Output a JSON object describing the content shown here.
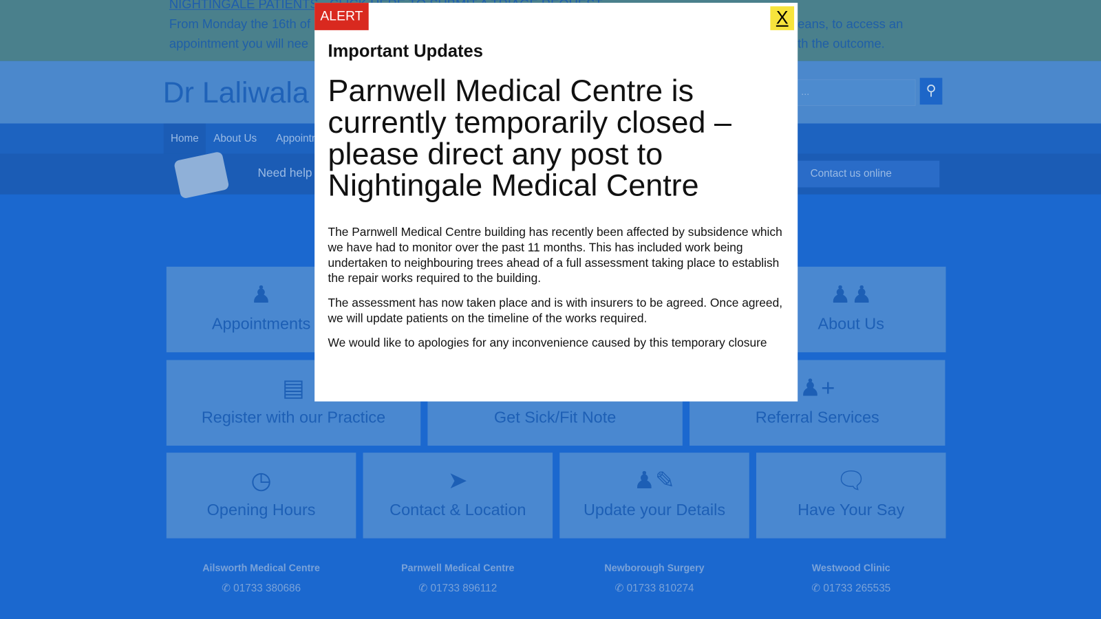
{
  "banner": {
    "line1": "NIGHTINGALE PATIENTS - CLICK HERE TO SUBMIT A TRIAGE REQUEST",
    "line2_left": "From Monday the 16th of",
    "line2_right": "eans, to access an",
    "line3_left": "appointment you will nee",
    "line3_right": "th the outcome."
  },
  "header": {
    "logo": "Dr Laliwala &",
    "search_placeholder": "...",
    "search_icon": "search-icon"
  },
  "nav": [
    "Home",
    "About Us",
    "Appointm"
  ],
  "helpbar": {
    "text": "Need help",
    "contact_button": "Contact us online"
  },
  "tiles": [
    {
      "label": "Appointments",
      "icon": "doctor-icon"
    },
    {
      "label": "About Us",
      "icon": "users-icon"
    },
    {
      "label": "Register with our Practice",
      "icon": "id-card-icon"
    },
    {
      "label": "Get Sick/Fit Note",
      "icon": "note-icon"
    },
    {
      "label": "Referral Services",
      "icon": "user-plus-icon"
    },
    {
      "label": "Opening Hours",
      "icon": "clock-icon"
    },
    {
      "label": "Contact & Location",
      "icon": "paper-plane-icon"
    },
    {
      "label": "Update your Details",
      "icon": "user-edit-icon"
    },
    {
      "label": "Have Your Say",
      "icon": "comments-icon"
    }
  ],
  "sites": [
    {
      "name": "Ailsworth Medical Centre",
      "phone": "01733 380686"
    },
    {
      "name": "Parnwell Medical Centre",
      "phone": "01733 896112"
    },
    {
      "name": "Newborough Surgery",
      "phone": "01733 810274"
    },
    {
      "name": "Westwood Clinic",
      "phone": "01733 265535"
    }
  ],
  "modal": {
    "badge": "ALERT",
    "close": "X",
    "title": "Important Updates",
    "headline": "Parnwell Medical Centre is currently temporarily closed – please direct any post to Nightingale Medical Centre",
    "paragraphs": [
      "The Parnwell Medical Centre building has recently been affected by subsidence which we have had to monitor over the past 11 months. This has included work being undertaken to neighbouring trees ahead of a full assessment taking place to establish the repair works required to the building.",
      "The assessment has now taken place and is with insurers to be agreed. Once agreed, we will update patients on the timeline of the works required.",
      "We would like to apologies for any inconvenience caused by this temporary closure"
    ]
  },
  "colors": {
    "alert": "#d9291f",
    "close_highlight": "#f7e43c",
    "brand_blue": "#1b68cf"
  }
}
